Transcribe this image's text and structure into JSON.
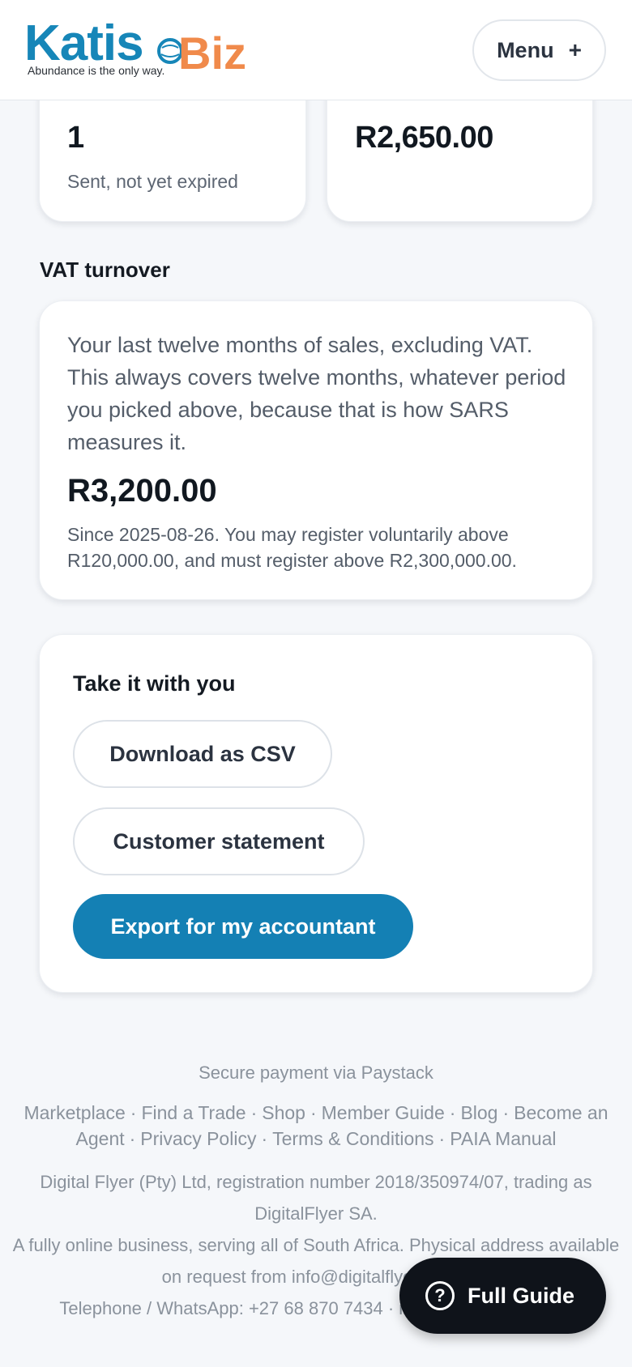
{
  "header": {
    "logo_main": "Katis",
    "logo_accent": "Biz",
    "logo_tagline": "Abundance is the only way.",
    "menu_label": "Menu",
    "menu_icon": "plus-icon"
  },
  "stats": [
    {
      "value": "1",
      "caption": "Sent, not yet expired"
    },
    {
      "value": "R2,650.00",
      "caption": ""
    }
  ],
  "vat": {
    "title": "VAT turnover",
    "description": "Your last twelve months of sales, excluding VAT. This always covers twelve months, whatever period you picked above, because that is how SARS measures it.",
    "amount": "R3,200.00",
    "note": "Since 2025-08-26. You may register voluntarily above R120,000.00, and must register above R2,300,000.00."
  },
  "export": {
    "title": "Take it with you",
    "csv_label": "Download as CSV",
    "statement_label": "Customer statement",
    "accountant_label": "Export for my accountant"
  },
  "footer": {
    "payment": "Secure payment via Paystack",
    "links": [
      "Marketplace",
      "Find a Trade",
      "Shop",
      "Member Guide",
      "Blog",
      "Become an Agent",
      "Privacy Policy",
      "Terms & Conditions",
      "PAIA Manual"
    ],
    "legal": "Digital Flyer (Pty) Ltd, registration number 2018/350974/07, trading as DigitalFlyer SA.",
    "online": "A fully online business, serving all of South Africa. Physical address available on request from info@digitalflyer.co.za.",
    "phone": "Telephone / WhatsApp: +27 68 870 7434 · info@digitalflyer.co.za"
  },
  "guide": {
    "label": "Full Guide",
    "icon": "question-circle-icon"
  },
  "colors": {
    "brand_blue": "#1480b4",
    "brand_orange": "#f08a4b",
    "background": "#f5f7fa"
  }
}
